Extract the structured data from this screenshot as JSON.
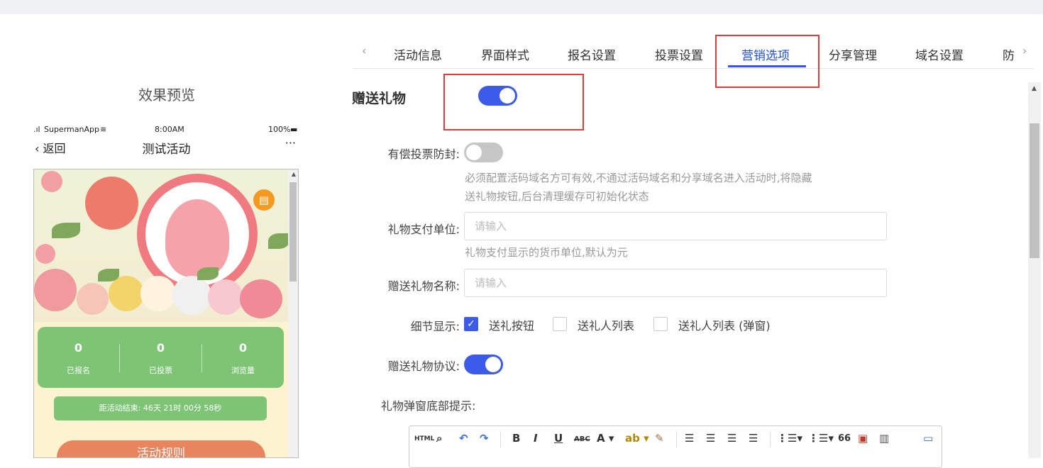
{
  "preview": {
    "title": "效果预览",
    "status_carrier": "SupermanApp",
    "status_time": "8:00AM",
    "status_battery": "100%",
    "back_label": "返回",
    "page_title": "测试活动",
    "more_label": "···",
    "stats": [
      {
        "value": "0",
        "label": "已报名"
      },
      {
        "value": "0",
        "label": "已投票"
      },
      {
        "value": "0",
        "label": "浏览量"
      }
    ],
    "countdown": "距活动结束: 46天 21时 00分 58秒",
    "rules_button": "活动规则"
  },
  "tabs": [
    {
      "label": "活动信息"
    },
    {
      "label": "界面样式"
    },
    {
      "label": "报名设置"
    },
    {
      "label": "投票设置"
    },
    {
      "label": "营销选项",
      "active": true
    },
    {
      "label": "分享管理"
    },
    {
      "label": "域名设置"
    },
    {
      "label": "防"
    }
  ],
  "form": {
    "section_title": "赠送礼物",
    "gift_enabled": true,
    "paid_vote_label": "有偿投票防封:",
    "paid_vote_enabled": false,
    "paid_vote_hint_line1": "必须配置活码域名方可有效,不通过活码域名和分享域名进入活动时,将隐藏",
    "paid_vote_hint_line2": "送礼物按钮,后台清理缓存可初始化状态",
    "currency_label": "礼物支付单位:",
    "currency_placeholder": "请输入",
    "currency_hint": "礼物支付显示的货币单位,默认为元",
    "gift_name_label": "赠送礼物名称:",
    "gift_name_placeholder": "请输入",
    "detail_label": "细节显示:",
    "detail_options": [
      {
        "label": "送礼按钮",
        "checked": true
      },
      {
        "label": "送礼人列表",
        "checked": false
      },
      {
        "label": "送礼人列表 (弹窗)",
        "checked": false
      }
    ],
    "agreement_label": "赠送礼物协议:",
    "agreement_enabled": true,
    "popup_footer_label": "礼物弹窗底部提示:"
  },
  "editor_toolbar": {
    "html": "HTML",
    "bold": "B",
    "italic": "I",
    "underline": "U",
    "strike": "ABC",
    "font_color": "A",
    "quote": "66"
  },
  "colors": {
    "accent": "#3c5be8",
    "highlight": "#e03c3c",
    "stats_green": "#7dc575",
    "rules_orange": "#e8855e"
  }
}
